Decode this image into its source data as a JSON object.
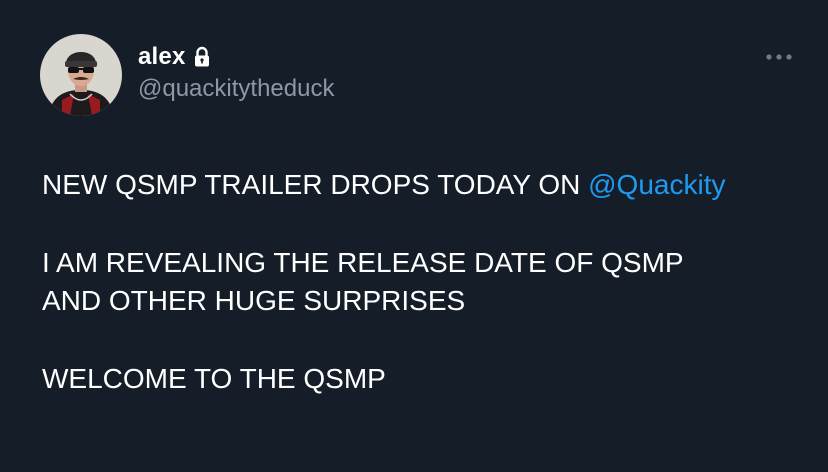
{
  "author": {
    "display_name": "alex",
    "handle": "@quackitytheduck",
    "protected_icon": "lock-icon",
    "avatar_icon": "profile-avatar"
  },
  "menu": {
    "icon": "more-horizontal-icon"
  },
  "tweet": {
    "line1_text": "NEW QSMP TRAILER DROPS TODAY ON ",
    "line1_mention": "@Quackity",
    "line2": "I AM REVEALING THE RELEASE DATE OF QSMP",
    "line3": "AND OTHER HUGE SURPRISES",
    "line4": "WELCOME TO THE QSMP"
  },
  "colors": {
    "background": "#151d28",
    "text_primary": "#ffffff",
    "text_secondary": "#8b98a5",
    "mention": "#1d9bf0"
  }
}
